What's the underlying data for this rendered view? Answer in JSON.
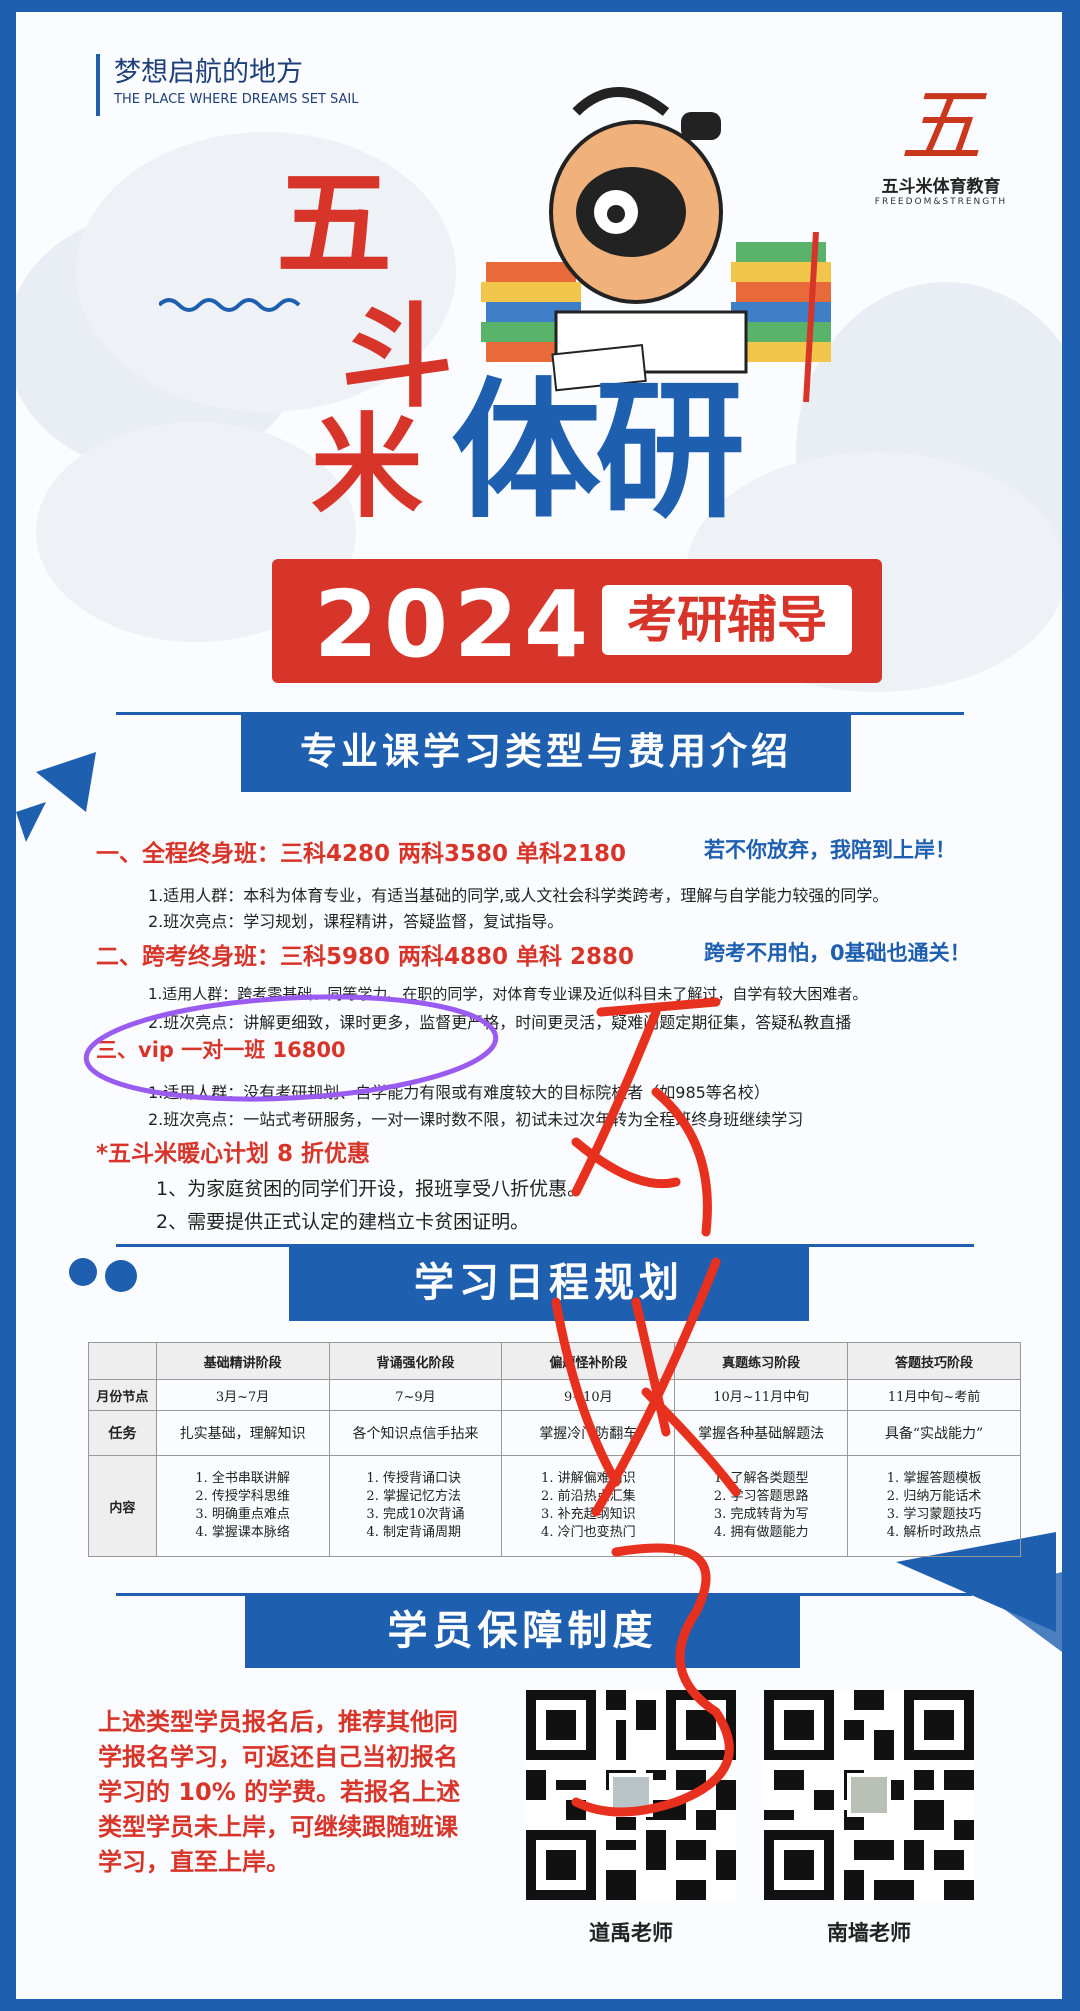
{
  "slogan": {
    "cn": "梦想启航的地方",
    "en": "THE PLACE WHERE DREAMS SET SAIL"
  },
  "logo": {
    "mark": "五",
    "cn": "五斗米体育教育",
    "en": "FREEDOM&STRENGTH"
  },
  "hero": {
    "wu": "五",
    "dou": "斗",
    "mi": "米",
    "tiyan": "体研",
    "year": "2024",
    "tag": "考研辅导"
  },
  "section1": {
    "title": "专业课学习类型与费用介绍",
    "item1": {
      "heading": "一、全程终身班：三科4280 两科3580 单科2180",
      "slogan": "若不你放弃，我陪到上岸！",
      "line1": "1.适用人群：本科为体育专业，有适当基础的同学,或人文社会科学类跨考，理解与自学能力较强的同学。",
      "line2": "2.班次亮点：学习规划，课程精讲，答疑监督，复试指导。"
    },
    "item2": {
      "heading": "二、跨考终身班：三科5980 两科4880 单科 2880",
      "slogan": "跨考不用怕，0基础也通关！",
      "line1": "1.适用人群：跨考零基础、同等学力、在职的同学，对体育专业课及近似科目未了解过，自学有较大困难者。",
      "line2": "2.班次亮点：讲解更细致，课时更多，监督更严格，时间更灵活，疑难问题定期征集，答疑私教直播"
    },
    "item3": {
      "heading": "三、vip 一对一班 16800",
      "line1": "1.适用人群：没有考研规划、自学能力有限或有难度较大的目标院校者（如985等名校）",
      "line2": "2.班次亮点：一站式考研服务，一对一课时数不限，初试未过次年转为全程班终身班继续学习"
    },
    "plan": {
      "heading": "*五斗米暖心计划 8 折优惠",
      "line1": "1、为家庭贫困的同学们开设，报班享受八折优惠。",
      "line2": "2、需要提供正式认定的建档立卡贫困证明。"
    }
  },
  "section2": {
    "title": "学习日程规划",
    "columns": [
      "基础精讲阶段",
      "背诵强化阶段",
      "偏题怪补阶段",
      "真题练习阶段",
      "答题技巧阶段"
    ],
    "row_labels": [
      "月份节点",
      "任务",
      "内容"
    ],
    "months": [
      "3月~7月",
      "7~9月",
      "9~10月",
      "10月~11月中旬",
      "11月中旬~考前"
    ],
    "tasks": [
      "扎实基础，理解知识",
      "各个知识点信手拈来",
      "掌握冷门防翻车",
      "掌握各种基础解题法",
      "具备“实战能力”"
    ],
    "contents": [
      [
        "1. 全书串联讲解",
        "2. 传授学科思维",
        "3. 明确重点难点",
        "4. 掌握课本脉络"
      ],
      [
        "1. 传授背诵口诀",
        "2. 掌握记忆方法",
        "3. 完成10次背诵",
        "4. 制定背诵周期"
      ],
      [
        "1. 讲解偏难知识",
        "2. 前沿热点汇集",
        "3. 补充超纲知识",
        "4. 冷门也变热门"
      ],
      [
        "1. 了解各类题型",
        "2. 学习答题思路",
        "3. 完成转背为写",
        "4. 拥有做题能力"
      ],
      [
        "1. 掌握答题模板",
        "2. 归纳万能话术",
        "3. 学习蒙题技巧",
        "4. 解析时政热点"
      ]
    ]
  },
  "section3": {
    "title": "学员保障制度",
    "text": "上述类型学员报名后，推荐其他同学报名学习，可返还自己当初报名学习的 10% 的学费。若报名上述类型学员未上岸，可继续跟随班课学习，直至上岸。",
    "qr1_label": "道禹老师",
    "qr2_label": "南墙老师"
  },
  "colors": {
    "brand_blue": "#1e5fb0",
    "brand_red": "#d8352a",
    "ink_red": "#e8301e",
    "ink_purple": "#9a5cf0"
  }
}
